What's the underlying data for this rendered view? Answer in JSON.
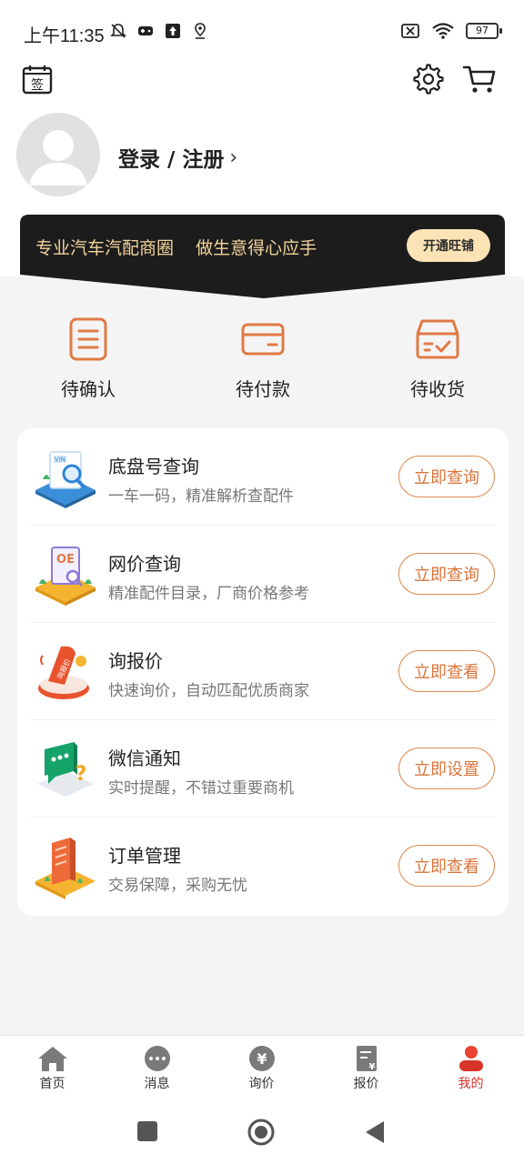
{
  "status_bar": {
    "time": "上午11:35",
    "battery": "97"
  },
  "profile": {
    "login_label": "登录 / 注册",
    "chevron": "›"
  },
  "promo": {
    "text": "专业汽车汽配商圈    做生意得心应手",
    "button_label": "开通旺铺"
  },
  "order_status": [
    {
      "label": "待确认",
      "icon": "clipboard-icon"
    },
    {
      "label": "待付款",
      "icon": "card-icon"
    },
    {
      "label": "待收货",
      "icon": "box-icon"
    }
  ],
  "services": [
    {
      "title": "底盘号查询",
      "desc": "一车一码，精准解析查配件",
      "button": "立即查询",
      "icon": "vin-search-icon",
      "badge": "VIN"
    },
    {
      "title": "网价查询",
      "desc": "精准配件目录，厂商价格参考",
      "button": "立即查询",
      "icon": "oe-price-icon",
      "badge": "OE"
    },
    {
      "title": "询报价",
      "desc": "快速询价，自动匹配优质商家",
      "button": "立即查看",
      "icon": "quote-icon",
      "badge": "询报价"
    },
    {
      "title": "微信通知",
      "desc": "实时提醒，不错过重要商机",
      "button": "立即设置",
      "icon": "wechat-notify-icon"
    },
    {
      "title": "订单管理",
      "desc": "交易保障，采购无忧",
      "button": "立即查看",
      "icon": "order-manage-icon"
    }
  ],
  "bottom_nav": [
    {
      "label": "首页",
      "icon": "home-icon",
      "active": false
    },
    {
      "label": "消息",
      "icon": "message-icon",
      "active": false
    },
    {
      "label": "询价",
      "icon": "inquiry-icon",
      "active": false
    },
    {
      "label": "报价",
      "icon": "quote-doc-icon",
      "active": false
    },
    {
      "label": "我的",
      "icon": "profile-icon",
      "active": true
    }
  ],
  "colors": {
    "accent": "#d9743a",
    "active_tab": "#d8332a",
    "banner_bg": "#1c1c1c",
    "banner_text": "#f2d49c"
  }
}
